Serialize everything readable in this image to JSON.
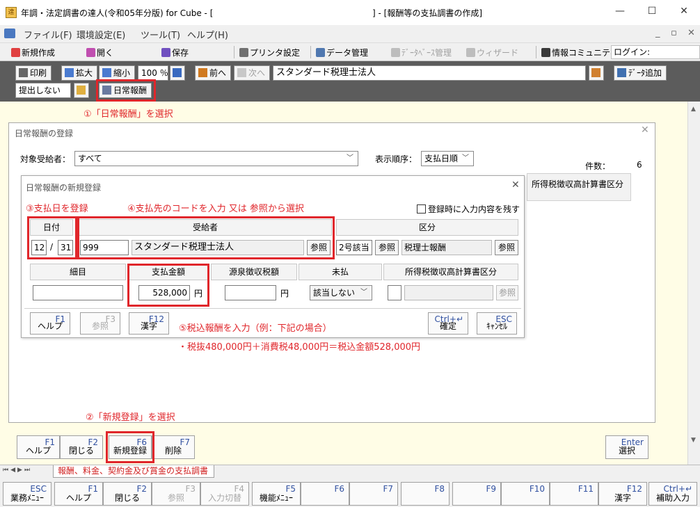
{
  "window": {
    "title": "年調・法定調書の達人(令和05年分版) for Cube  -  [",
    "title_suffix": "] - [報酬等の支払調書の作成]",
    "minimize": "—",
    "maximize": "☐",
    "close": "✕"
  },
  "menu": {
    "items": [
      "ファイル(F)",
      "環境設定(E)",
      "ツール(T)",
      "ヘルプ(H)"
    ],
    "right": [
      "_",
      "▫",
      "✕"
    ]
  },
  "toolbar1": {
    "new": "新規作成",
    "open": "開く",
    "save": "保存",
    "printer_setup": "プリンタ設定",
    "data_mgmt": "データ管理",
    "db_mgmt": "ﾃﾞｰﾀﾍﾞｰｽ管理",
    "wizard": "ウィザード",
    "info_community": "情報コミュニティ",
    "login": "ログイン:"
  },
  "toolbar2": {
    "print": "印刷",
    "zoom_in": "拡大",
    "zoom_out": "縮小",
    "zoom_value": "100 ％",
    "prev": "前へ",
    "next": "次へ",
    "record_name": "スタンダード税理士法人",
    "add_data": "ﾃﾞｰﾀ追加",
    "submit_select": "提出しない",
    "daily_reward": "日常報酬"
  },
  "annotations": {
    "a1": "①「日常報酬」を選択",
    "a2": "②「新規登録」を選択",
    "a3": "③支払日を登録",
    "a4": "④支払先のコードを入力 又は 参照から選択",
    "a5": "⑤税込報酬を入力（例：下記の場合）",
    "a5_detail": "・税抜480,000円＋消費税48,000円＝税込金額528,000円"
  },
  "outer_dialog": {
    "title": "日常報酬の登録",
    "target_label": "対象受給者：",
    "target_value": "すべて",
    "order_label": "表示順序：",
    "order_value": "支払日順",
    "count_label": "件数：",
    "count_value": "6",
    "col_right": "所得税徴収高計算書区分",
    "fkeys": [
      {
        "key": "F1",
        "label": "ヘルプ"
      },
      {
        "key": "F2",
        "label": "閉じる"
      },
      {
        "key": "F6",
        "label": "新規登録"
      },
      {
        "key": "F7",
        "label": "削除"
      },
      {
        "key": "Enter",
        "label": "選択"
      }
    ]
  },
  "inner_dialog": {
    "title": "日常報酬の新規登録",
    "keep_input": "登録時に入力内容を残す",
    "headers": {
      "date": "日付",
      "payee": "受給者",
      "category": "区分",
      "detail": "細目",
      "amount": "支払金額",
      "withholding": "源泉徴収税額",
      "unpaid": "未払",
      "tax_category": "所得税徴収高計算書区分"
    },
    "month": "12",
    "slash": "/",
    "day": "31",
    "payee_code": "999",
    "payee_name": "スタンダード税理士法人",
    "ref": "参照",
    "category_code": "2号該当",
    "category_name": "税理士報酬",
    "amount": "528,000",
    "yen": "円",
    "unpaid_value": "該当しない",
    "fkeys": [
      {
        "key": "F1",
        "label": "ヘルプ"
      },
      {
        "key": "F3",
        "label": "参照"
      },
      {
        "key": "F12",
        "label": "漢字"
      },
      {
        "key": "Ctrl+↵",
        "label": "確定"
      },
      {
        "key": "ESC",
        "label": "ｷｬﾝｾﾙ"
      }
    ]
  },
  "tab": {
    "label": "報酬、料金、契約金及び賞金の支払調書"
  },
  "bottom_fkeys": [
    {
      "key": "ESC",
      "label": "業務ﾒﾆｭｰ"
    },
    {
      "key": "F1",
      "label": "ヘルプ"
    },
    {
      "key": "F2",
      "label": "閉じる"
    },
    {
      "key": "F3",
      "label": "参照"
    },
    {
      "key": "F4",
      "label": "入力切替"
    },
    {
      "key": "F5",
      "label": "機能ﾒﾆｭｰ"
    },
    {
      "key": "F6",
      "label": ""
    },
    {
      "key": "F7",
      "label": ""
    },
    {
      "key": "F8",
      "label": ""
    },
    {
      "key": "F9",
      "label": ""
    },
    {
      "key": "F10",
      "label": ""
    },
    {
      "key": "F11",
      "label": ""
    },
    {
      "key": "F12",
      "label": "漢字"
    },
    {
      "key": "Ctrl+↵",
      "label": "補助入力"
    }
  ]
}
